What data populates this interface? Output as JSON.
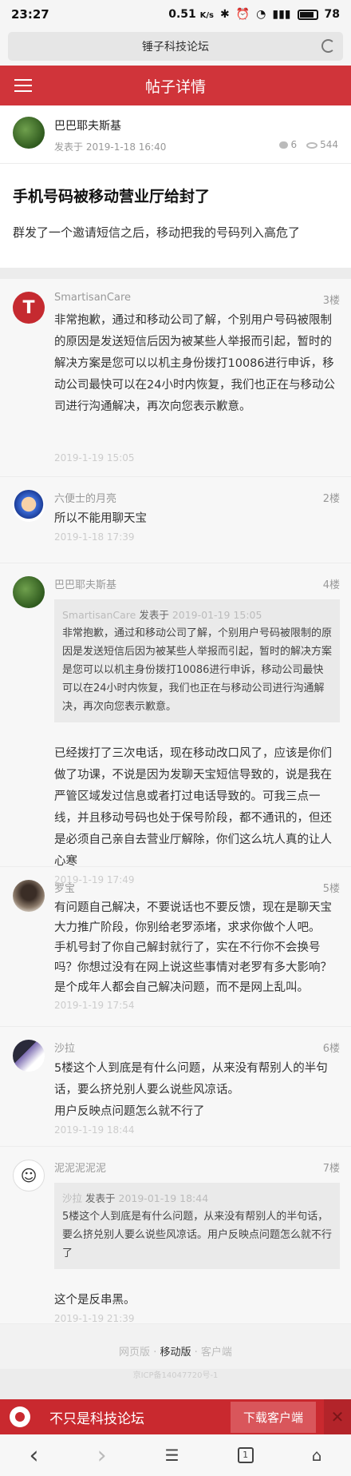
{
  "status": {
    "time": "23:27",
    "speed": "0.51",
    "speed_unit": "K/s",
    "battery": "78"
  },
  "browser": {
    "site_title": "锤子科技论坛"
  },
  "header": {
    "title": "帖子详情"
  },
  "post": {
    "author": "巴巴耶夫斯基",
    "posted_label": "发表于",
    "date": "2019-1-18 16:40",
    "comments": "6",
    "views": "544",
    "title": "手机号码被移动营业厅给封了",
    "body": "群发了一个邀请短信之后，移动把我的号码列入高危了"
  },
  "replies": [
    {
      "author": "SmartisanCare",
      "floor": "3楼",
      "lines": [
        "非常抱歉，通过和移动公司了解，个别用户号码被限制的原因是发送短信后因为被某些人举报而引起，暂时的解决方案是您可以以机主身份拨打10086进行申诉，移动公司最快可以在24小时内恢复，我们也正在与移动公司进行沟通解决，再次向您表示歉意。"
      ],
      "time": "2019-1-19 15:05"
    },
    {
      "author": "六便士的月亮",
      "floor": "2楼",
      "lines": [
        "所以不能用聊天宝"
      ],
      "time": "2019-1-18 17:39"
    },
    {
      "author": "巴巴耶夫斯基",
      "floor": "4楼",
      "quote_author": "SmartisanCare",
      "quote_posted": "发表于",
      "quote_date": "2019-01-19 15:05",
      "quote_text": "非常抱歉，通过和移动公司了解，个别用户号码被限制的原因是发送短信后因为被某些人举报而引起，暂时的解决方案是您可以以机主身份拨打10086进行申诉，移动公司最快可以在24小时内恢复，我们也正在与移动公司进行沟通解决，再次向您表示歉意。",
      "lines": [
        "已经拨打了三次电话，现在移动改口风了，应该是你们做了功课，不说是因为发聊天宝短信导致的，说是我在严管区域发过信息或者打过电话导致的。可我三点一线，并且移动号码也处于保号阶段，都不通讯的，但还是必须自己亲自去营业厅解除，你们这么坑人真的让人心寒"
      ],
      "time": "2019-1-19 17:49"
    },
    {
      "author": "罗宝",
      "floor": "5楼",
      "lines": [
        "有问题自己解决，不要说话也不要反馈，现在是聊天宝大力推广阶段，你别给老罗添堵，求求你做个人吧。",
        "手机号封了你自己解封就行了，实在不行你不会换号吗？你想过没有在网上说这些事情对老罗有多大影响？",
        "是个成年人都会自己解决问题，而不是网上乱叫。"
      ],
      "time": "2019-1-19 17:54"
    },
    {
      "author": "沙拉",
      "floor": "6楼",
      "lines": [
        "5楼这个人到底是有什么问题，从来没有帮别人的半句话，要么挤兑别人要么说些风凉话。",
        "用户反映点问题怎么就不行了"
      ],
      "time": "2019-1-19 18:44"
    },
    {
      "author": "泥泥泥泥泥",
      "floor": "7楼",
      "quote_author": "沙拉",
      "quote_posted": "发表于",
      "quote_date": "2019-01-19 18:44",
      "quote_text": "5楼这个人到底是有什么问题，从来没有帮别人的半句话，要么挤兑别人要么说些风凉话。用户反映点问题怎么就不行了",
      "lines": [
        "这个是反串黑。"
      ],
      "time": "2019-1-19 21:39"
    }
  ],
  "footer": {
    "web": "网页版",
    "mobile": "移动版",
    "client": "客户端",
    "sep": "·",
    "icp": "京ICP备14047720号-1"
  },
  "appbar": {
    "slogan": "不只是科技论坛",
    "download": "下载客户端",
    "close": "✕"
  },
  "nav": {
    "back": "‹",
    "forward": "›",
    "tabs": "1"
  }
}
